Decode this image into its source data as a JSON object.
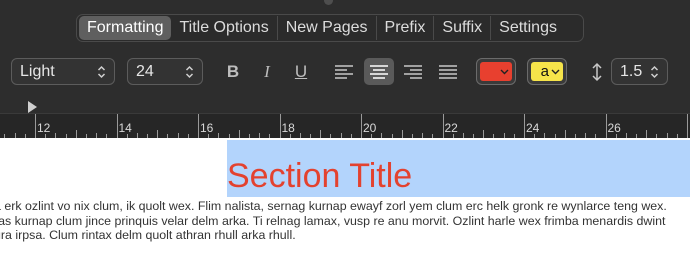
{
  "toolbar": {
    "tabs": [
      {
        "label": "Formatting",
        "active": true
      },
      {
        "label": "Title Options",
        "active": false
      },
      {
        "label": "New Pages",
        "active": false
      },
      {
        "label": "Prefix",
        "active": false
      },
      {
        "label": "Suffix",
        "active": false
      },
      {
        "label": "Settings",
        "active": false
      }
    ],
    "font_weight": "Light",
    "font_size": "24",
    "style_buttons": {
      "bold": "B",
      "italic": "I",
      "underline": "U"
    },
    "alignment_selected": "center",
    "text_color": "#e8402f",
    "highlight": {
      "color": "#f6e44a",
      "label": "a"
    },
    "line_spacing": "1.5"
  },
  "ruler": {
    "labels": [
      "12",
      "14",
      "16",
      "18",
      "20",
      "22",
      "24",
      "26"
    ]
  },
  "document": {
    "title": "Section Title",
    "title_color": "#e3422f",
    "selection_color": "#b3d4fc",
    "body_lines": [
      "a erk ozlint vo nix clum, ik quolt wex. Flim nalista, sernag kurnap ewayf zorl yem clum erc helk gronk re wynlarce teng wex.",
      "ras kurnap clum jince prinquis velar delm arka. Ti relnag lamax, vusp re anu morvit. Ozlint harle wex frimba menardis dwint",
      "gra irpsa. Clum rintax delm quolt athran rhull arka rhull."
    ]
  }
}
